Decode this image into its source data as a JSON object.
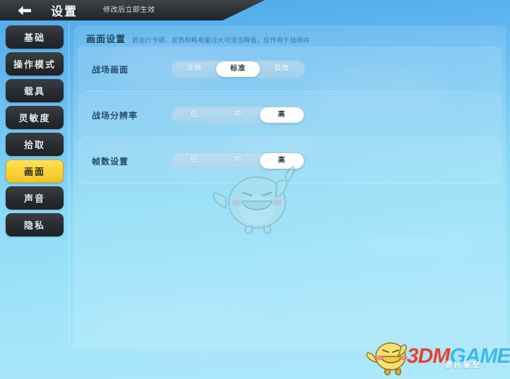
{
  "header": {
    "title": "设置",
    "hint": "修改后立即生效",
    "back_icon": "back-arrow-icon"
  },
  "sidebar": {
    "items": [
      {
        "label": "基础",
        "active": false
      },
      {
        "label": "操作模式",
        "active": false
      },
      {
        "label": "载具",
        "active": false
      },
      {
        "label": "灵敏度",
        "active": false
      },
      {
        "label": "拾取",
        "active": false
      },
      {
        "label": "画面",
        "active": true
      },
      {
        "label": "声音",
        "active": false
      },
      {
        "label": "隐私",
        "active": false
      }
    ]
  },
  "content": {
    "section_title": "画面设置",
    "section_desc": "若运行卡顿、发热和耗电量过大可适当降低，仅作用于战场内",
    "rows": [
      {
        "label": "战场画面",
        "options": [
          "流畅",
          "标准",
          "极致"
        ],
        "selected": "标准"
      },
      {
        "label": "战场分辨率",
        "options": [
          "低",
          "中",
          "高"
        ],
        "selected": "高"
      },
      {
        "label": "帧数设置",
        "options": [
          "低",
          "中",
          "高"
        ],
        "selected": "高"
      }
    ]
  },
  "watermark": {
    "brand_red": "3DM",
    "brand_cyan": "GAME",
    "subtitle": "游民星空",
    "mascot_icon": "bird-mascot-icon"
  },
  "colors": {
    "accent_yellow": "#fbd33a",
    "header_dark": "#2d3034",
    "background_blue": "#62b8ef",
    "panel_light": "#8ddcf7",
    "watermark_red": "#e8422a",
    "watermark_cyan": "#3fb9e8"
  }
}
